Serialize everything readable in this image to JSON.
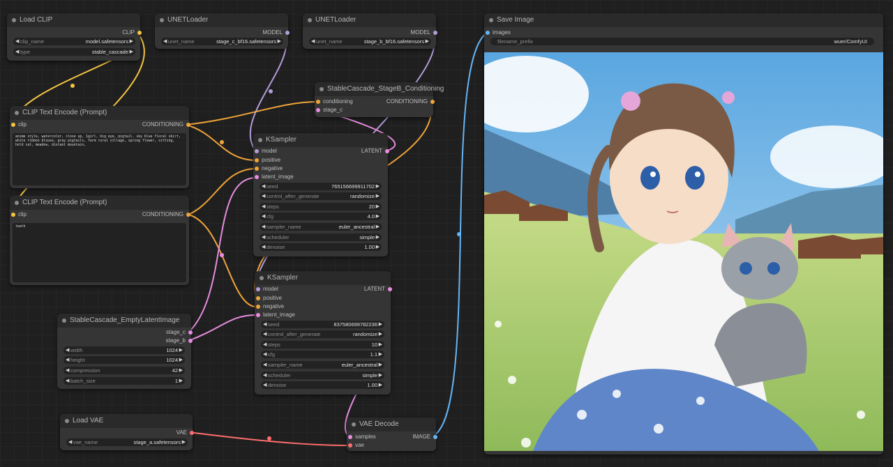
{
  "colors": {
    "clip": "#f5c542",
    "model": "#b39ddb",
    "conditioning": "#f0a53a",
    "latent": "#e88de0",
    "vae": "#ff6e6e",
    "image": "#64b5f6"
  },
  "load_clip": {
    "title": "Load CLIP",
    "out_clip": "CLIP",
    "clip_name_label": "clip_name",
    "clip_name_value": "model.safetensors",
    "type_label": "type",
    "type_value": "stable_cascade"
  },
  "unet_c": {
    "title": "UNETLoader",
    "out_model": "MODEL",
    "unet_name_label": "unet_name",
    "unet_name_value": "stage_c_bf16.safetensors"
  },
  "unet_b": {
    "title": "UNETLoader",
    "out_model": "MODEL",
    "unet_name_label": "unet_name",
    "unet_name_value": "stage_b_bf16.safetensors"
  },
  "clip_pos": {
    "title": "CLIP Text Encode (Prompt)",
    "in_clip": "clip",
    "out": "CONDITIONING",
    "text": "anime style, watercolor, close up, 1girl, big eye, pigtail, sky blue floral skirt, white ribbon blouse, gray pigtails, farm rural village, spring flower, sitting, hold cat, meadow, distant mountain,"
  },
  "clip_neg": {
    "title": "CLIP Text Encode (Prompt)",
    "in_clip": "clip",
    "out": "CONDITIONING",
    "text": "teeth"
  },
  "stageb_cond": {
    "title": "StableCascade_StageB_Conditioning",
    "in_cond": "conditioning",
    "in_stage_c": "stage_c",
    "out": "CONDITIONING"
  },
  "ksampler1": {
    "title": "KSampler",
    "in_model": "model",
    "in_positive": "positive",
    "in_negative": "negative",
    "in_latent": "latent_image",
    "out": "LATENT",
    "widgets": [
      {
        "label": "seed",
        "value": "765156699911702"
      },
      {
        "label": "control_after_generate",
        "value": "randomize"
      },
      {
        "label": "steps",
        "value": "20"
      },
      {
        "label": "cfg",
        "value": "4.0"
      },
      {
        "label": "sampler_name",
        "value": "euler_ancestral"
      },
      {
        "label": "scheduler",
        "value": "simple"
      },
      {
        "label": "denoise",
        "value": "1.00"
      }
    ]
  },
  "ksampler2": {
    "title": "KSampler",
    "in_model": "model",
    "in_positive": "positive",
    "in_negative": "negative",
    "in_latent": "latent_image",
    "out": "LATENT",
    "widgets": [
      {
        "label": "seed",
        "value": "837580699782236"
      },
      {
        "label": "control_after_generate",
        "value": "randomize"
      },
      {
        "label": "steps",
        "value": "10"
      },
      {
        "label": "cfg",
        "value": "1.1"
      },
      {
        "label": "sampler_name",
        "value": "euler_ancestral"
      },
      {
        "label": "scheduler",
        "value": "simple"
      },
      {
        "label": "denoise",
        "value": "1.00"
      }
    ]
  },
  "empty_latent": {
    "title": "StableCascade_EmptyLatentImage",
    "out_stage_c": "stage_c",
    "out_stage_b": "stage_b",
    "widgets": [
      {
        "label": "width",
        "value": "1024"
      },
      {
        "label": "height",
        "value": "1024"
      },
      {
        "label": "compression",
        "value": "42"
      },
      {
        "label": "batch_size",
        "value": "1"
      }
    ]
  },
  "load_vae": {
    "title": "Load VAE",
    "out_vae": "VAE",
    "vae_name_label": "vae_name",
    "vae_name_value": "stage_a.safetensors"
  },
  "vae_decode": {
    "title": "VAE Decode",
    "in_samples": "samples",
    "in_vae": "vae",
    "out": "IMAGE"
  },
  "save_image": {
    "title": "Save Image",
    "in_images": "images",
    "prefix_label": "filename_prefix",
    "prefix_value": "wuer/ComfyUI"
  },
  "arrows": {
    "left": "◀",
    "right": "▶"
  }
}
